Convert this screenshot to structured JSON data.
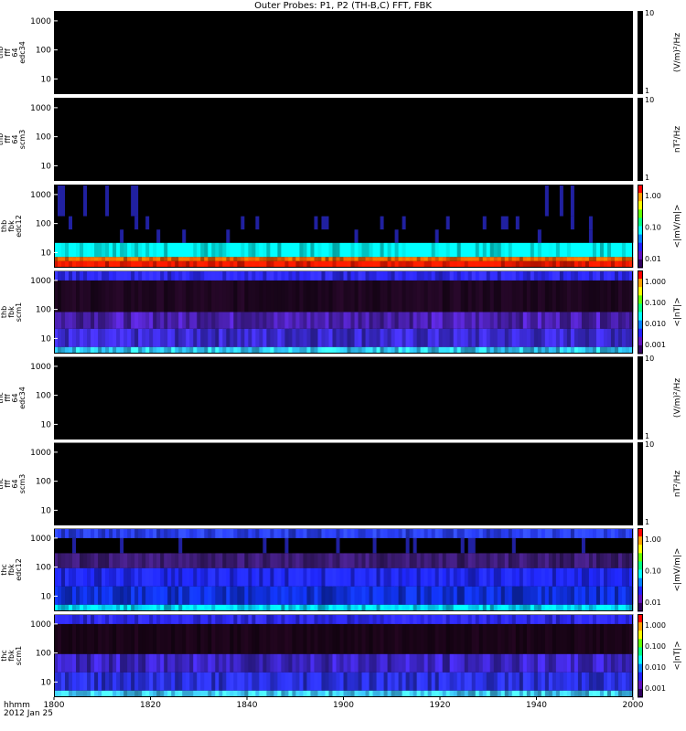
{
  "title": "Outer Probes: P1, P2 (TH-B,C) FFT, FBK",
  "xaxis": {
    "label_line1": "hhmm",
    "label_line2": "2012 Jan 25",
    "ticks": [
      "1800",
      "1820",
      "1840",
      "1900",
      "1920",
      "1940",
      "2000"
    ]
  },
  "colors": {
    "background": "#000000",
    "separator": "#ffffff"
  },
  "chart_data": [
    {
      "type": "heatmap",
      "id": "p1",
      "ylabel": [
        "thb",
        "fff",
        "64",
        "edc34"
      ],
      "yticks": [
        "10",
        "100",
        "1000"
      ],
      "cbar_label": "(V/m)²/Hz",
      "cbar_ticks": [
        "10",
        "1"
      ],
      "content": "empty"
    },
    {
      "type": "heatmap",
      "id": "p2",
      "ylabel": [
        "thb",
        "fff",
        "64",
        "scm3"
      ],
      "yticks": [
        "10",
        "100",
        "1000"
      ],
      "cbar_label": "nT²/Hz",
      "cbar_ticks": [
        "10",
        "1"
      ],
      "content": "empty"
    },
    {
      "type": "heatmap",
      "id": "p3",
      "ylabel": [
        "thb",
        "fbk",
        "edc12"
      ],
      "yticks": [
        "10",
        "100",
        "1000"
      ],
      "cbar_label": "<|mV/m|>",
      "cbar_ticks": [
        "1.00",
        "0.10",
        "0.01"
      ],
      "content": "spectrogram",
      "bands": [
        {
          "from": 0.0,
          "to": 0.08,
          "color": "#ff1a00"
        },
        {
          "from": 0.08,
          "to": 0.13,
          "color": "#ff6600"
        },
        {
          "from": 0.13,
          "to": 0.3,
          "color": "#00ffff"
        },
        {
          "from": 0.3,
          "to": 0.46,
          "color": "#000000"
        },
        {
          "from": 0.46,
          "to": 0.62,
          "color": "#000000"
        },
        {
          "from": 0.62,
          "to": 1.0,
          "color": "#000000"
        }
      ],
      "seed": 3
    },
    {
      "type": "heatmap",
      "id": "p4",
      "ylabel": [
        "thb",
        "fbk",
        "scm1"
      ],
      "yticks": [
        "10",
        "100",
        "1000"
      ],
      "cbar_label": "<|nT|>",
      "cbar_ticks": [
        "1.000",
        "0.100",
        "0.010",
        "0.001"
      ],
      "content": "spectrogram",
      "bands": [
        {
          "from": 0.0,
          "to": 0.08,
          "color": "#30c8ff"
        },
        {
          "from": 0.08,
          "to": 0.3,
          "color": "#3a2ad0"
        },
        {
          "from": 0.3,
          "to": 0.5,
          "color": "#4a20b0"
        },
        {
          "from": 0.5,
          "to": 0.88,
          "color": "#1e0620"
        },
        {
          "from": 0.88,
          "to": 1.0,
          "color": "#2e2aff"
        }
      ],
      "seed": 7
    },
    {
      "type": "heatmap",
      "id": "p5",
      "ylabel": [
        "thc",
        "fff",
        "64",
        "edc34"
      ],
      "yticks": [
        "10",
        "100",
        "1000"
      ],
      "cbar_label": "(V/m)²/Hz",
      "cbar_ticks": [
        "10",
        "1"
      ],
      "content": "empty"
    },
    {
      "type": "heatmap",
      "id": "p6",
      "ylabel": [
        "thc",
        "fff",
        "64",
        "scm3"
      ],
      "yticks": [
        "10",
        "100",
        "1000"
      ],
      "cbar_label": "nT²/Hz",
      "cbar_ticks": [
        "10",
        "1"
      ],
      "content": "empty"
    },
    {
      "type": "heatmap",
      "id": "p7",
      "ylabel": [
        "thc",
        "fbk",
        "edc12"
      ],
      "yticks": [
        "10",
        "100",
        "1000"
      ],
      "cbar_label": "<|mV/m|>",
      "cbar_ticks": [
        "1.00",
        "0.10",
        "0.01"
      ],
      "content": "spectrogram",
      "bands": [
        {
          "from": 0.0,
          "to": 0.08,
          "color": "#00d8ff"
        },
        {
          "from": 0.08,
          "to": 0.3,
          "color": "#1030e0"
        },
        {
          "from": 0.3,
          "to": 0.52,
          "color": "#2028ff"
        },
        {
          "from": 0.52,
          "to": 0.7,
          "color": "#3a1a70"
        },
        {
          "from": 0.7,
          "to": 0.88,
          "color": "#000000"
        },
        {
          "from": 0.88,
          "to": 1.0,
          "color": "#2a40ff"
        }
      ],
      "seed": 11
    },
    {
      "type": "heatmap",
      "id": "p8",
      "ylabel": [
        "thc",
        "fbk",
        "scm1"
      ],
      "yticks": [
        "10",
        "100",
        "1000"
      ],
      "cbar_label": "<|nT|>",
      "cbar_ticks": [
        "1.000",
        "0.100",
        "0.010",
        "0.001"
      ],
      "content": "spectrogram",
      "bands": [
        {
          "from": 0.0,
          "to": 0.08,
          "color": "#40c8ff"
        },
        {
          "from": 0.08,
          "to": 0.3,
          "color": "#2a30e0"
        },
        {
          "from": 0.3,
          "to": 0.52,
          "color": "#3a24c0"
        },
        {
          "from": 0.52,
          "to": 0.88,
          "color": "#1a0418"
        },
        {
          "from": 0.88,
          "to": 1.0,
          "color": "#2f2aff"
        }
      ],
      "seed": 19
    }
  ]
}
